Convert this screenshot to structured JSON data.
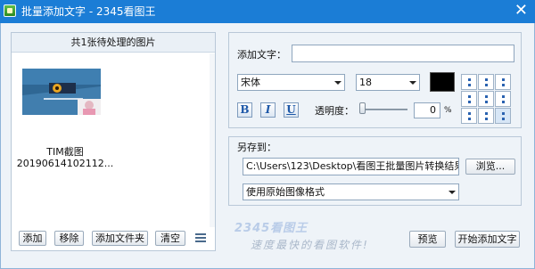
{
  "window": {
    "title": "批量添加文字 - 2345看图王",
    "close_glyph": "✕",
    "icon": "app-icon"
  },
  "left_panel": {
    "header": "共1张待处理的图片",
    "images": [
      {
        "name_line1": "TIM截图",
        "name_line2": "20190614102112..."
      }
    ],
    "buttons": {
      "add": "添加",
      "remove": "移除",
      "add_folder": "添加文件夹",
      "clear": "清空"
    },
    "list_view_icon": "list-icon"
  },
  "text_settings": {
    "add_text_label": "添加文字：",
    "add_text_value": "",
    "font": "宋体",
    "size": "18",
    "color": "#000000",
    "bold": "B",
    "italic": "I",
    "underline": "U",
    "opacity_label": "透明度：",
    "opacity_value": "0",
    "opacity_unit": "%",
    "position_grid_selected": "bottom-right"
  },
  "save_settings": {
    "save_to_label": "另存到：",
    "path": "C:\\Users\\123\\Desktop\\看图王批量图片转换结果\\",
    "browse": "浏览...",
    "format": "使用原始图像格式"
  },
  "footer": {
    "brand": "2345看图王",
    "slogan": "速度最快的看图软件!",
    "preview": "预览",
    "start": "开始添加文字"
  }
}
